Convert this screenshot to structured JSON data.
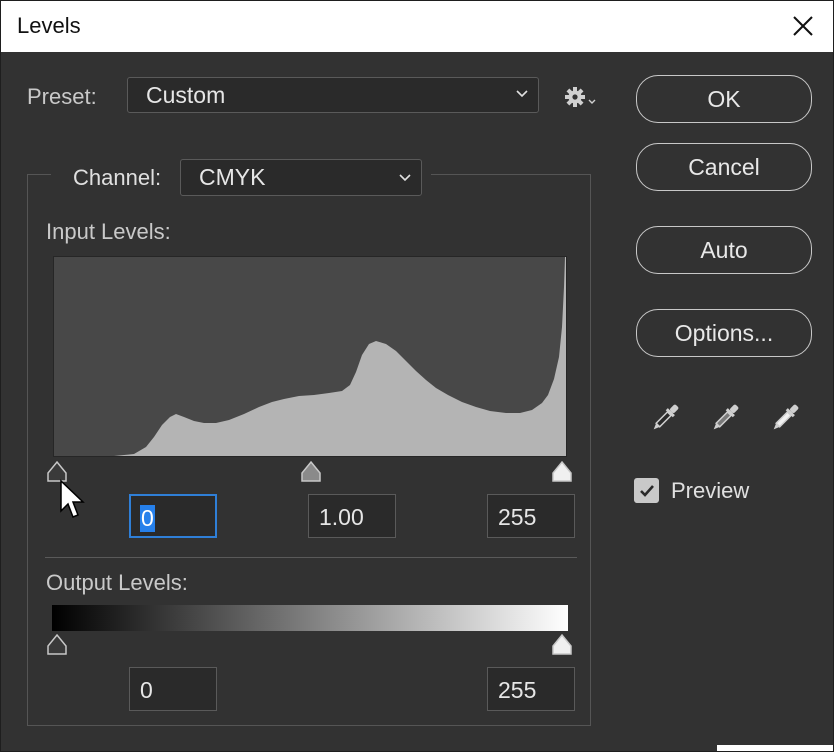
{
  "window": {
    "title": "Levels"
  },
  "preset": {
    "label": "Preset:",
    "value": "Custom"
  },
  "channel": {
    "label": "Channel:",
    "value": "CMYK"
  },
  "input_levels": {
    "label": "Input Levels:",
    "black": "0",
    "gamma": "1.00",
    "white": "255"
  },
  "output_levels": {
    "label": "Output Levels:",
    "black": "0",
    "white": "255"
  },
  "buttons": {
    "ok": "OK",
    "cancel": "Cancel",
    "auto": "Auto",
    "options": "Options..."
  },
  "preview": {
    "label": "Preview",
    "checked": true
  },
  "icons": {
    "settings": "gear-icon",
    "eyedroppers": [
      "black-point-eyedropper-icon",
      "gray-point-eyedropper-icon",
      "white-point-eyedropper-icon"
    ]
  },
  "colors": {
    "dialog_bg": "#323232",
    "accent": "#2680eb",
    "histogram_fill": "#b4b4b4",
    "histogram_bg": "#484848"
  }
}
